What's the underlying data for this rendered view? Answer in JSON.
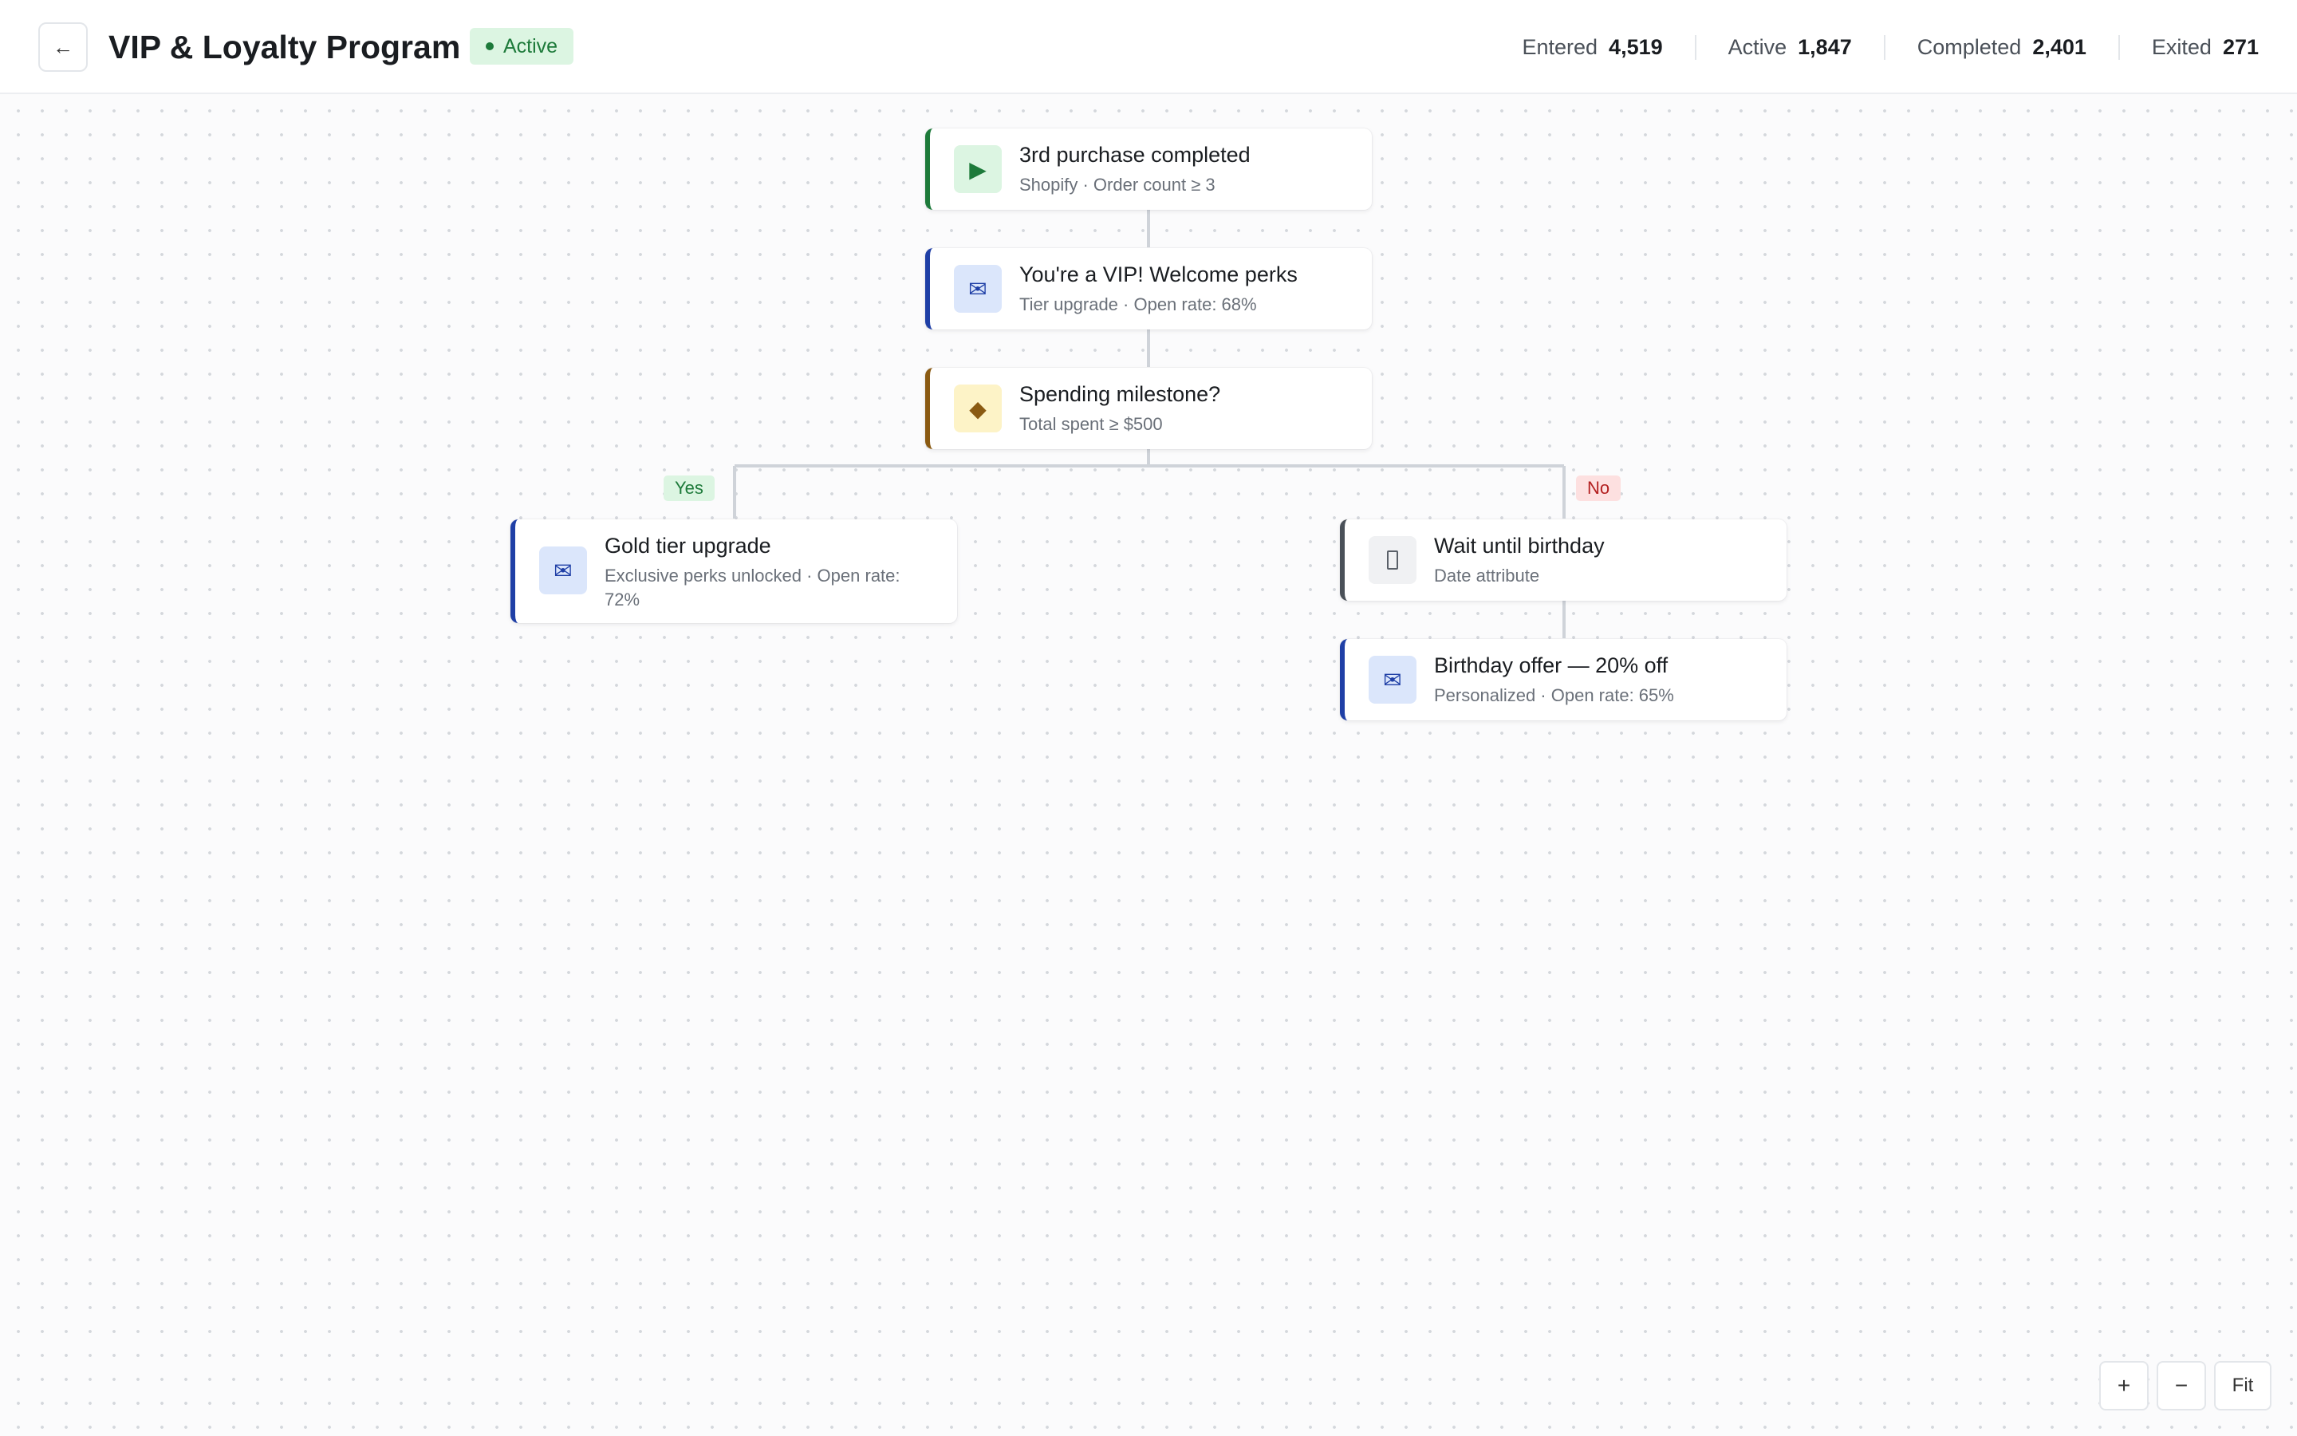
{
  "header": {
    "back_icon": "←",
    "title": "VIP & Loyalty Program",
    "status": "Active"
  },
  "stats": [
    {
      "label": "Entered",
      "value": "4,519"
    },
    {
      "label": "Active",
      "value": "1,847"
    },
    {
      "label": "Completed",
      "value": "2,401"
    },
    {
      "label": "Exited",
      "value": "271"
    }
  ],
  "nodes": {
    "trigger": {
      "icon": "▶",
      "icon_name": "play-icon",
      "title": "3rd purchase completed",
      "subtitle": "Shopify · Order count ≥ 3",
      "accent": "#1d7a3a"
    },
    "welcome": {
      "icon": "✉",
      "icon_name": "mail-icon",
      "title": "You're a VIP! Welcome perks",
      "subtitle": "Tier upgrade · Open rate: 68%",
      "accent": "#1f3fa6"
    },
    "condition": {
      "icon": "◆",
      "icon_name": "diamond-icon",
      "title": "Spending milestone?",
      "subtitle": "Total spent ≥ $500",
      "accent": "#8a5a12"
    },
    "gold": {
      "icon": "✉",
      "icon_name": "mail-icon",
      "title": "Gold tier upgrade",
      "subtitle": "Exclusive perks unlocked · Open rate: 72%",
      "accent": "#1f3fa6"
    },
    "wait": {
      "icon": "",
      "icon_name": "clock-icon",
      "title": "Wait until birthday",
      "subtitle": "Date attribute",
      "accent": "#4a5058"
    },
    "birthday": {
      "icon": "✉",
      "icon_name": "mail-icon",
      "title": "Birthday offer — 20% off",
      "subtitle": "Personalized · Open rate: 65%",
      "accent": "#1f3fa6"
    }
  },
  "branches": {
    "yes": "Yes",
    "no": "No"
  },
  "zoom": {
    "in": "+",
    "out": "−",
    "fit": "Fit"
  }
}
